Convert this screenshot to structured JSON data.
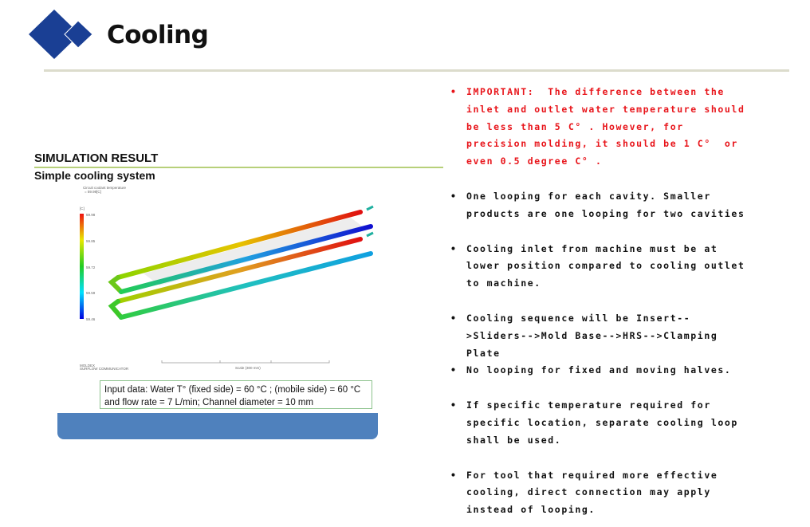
{
  "header": {
    "title": "Cooling",
    "accent_color": "#1a3f94"
  },
  "simulation": {
    "heading": "SIMULATION RESULT",
    "subheading": "Simple cooling system",
    "legend_title": "Circuit coolant temperature",
    "legend_subtitle": "= 59.98[C]",
    "legend_unit": "[C]",
    "legend_ticks": [
      "59.98",
      "59.85",
      "59.72",
      "59.59",
      "59.46"
    ],
    "scale_label": "Scale (300 mm)",
    "watermark_line1": "MOLDEX",
    "watermark_line2": "SURFLOW COMMUNICATOR",
    "input_line1": "Input data: Water T° (fixed side) = 60 °C ; (mobile side) = 60 °C",
    "input_line2": "and flow rate = 7 L/min; Channel diameter = 10 mm"
  },
  "bullets": [
    {
      "important": true,
      "lines": [
        "IMPORTANT:  The difference between the",
        "inlet and outlet water temperature should",
        "be less than 5 C° . However, for",
        "precision molding, it should be 1 C°  or",
        "even 0.5 degree C° ."
      ]
    },
    {
      "lines": [
        "One looping for each cavity. Smaller",
        "products are one looping for two cavities"
      ]
    },
    {
      "lines": [
        "Cooling inlet from machine must be at",
        "lower position compared to cooling outlet",
        "to machine."
      ]
    },
    {
      "lines": [
        "Cooling sequence will be Insert--",
        ">Sliders-->Mold Base-->HRS-->Clamping",
        "Plate"
      ]
    },
    {
      "lines": [
        "No looping for fixed and moving halves."
      ]
    },
    {
      "lines": [
        "If specific temperature required for",
        "specific location, separate cooling loop",
        "shall be used."
      ]
    },
    {
      "lines": [
        "For tool that required more effective",
        "cooling, direct connection may apply",
        "instead of looping."
      ]
    }
  ],
  "bullet_symbol": "•"
}
